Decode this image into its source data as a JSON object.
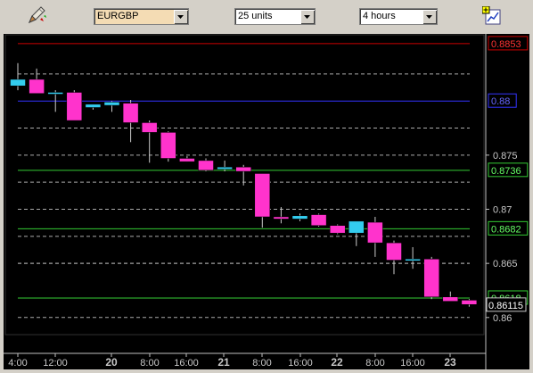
{
  "toolbar": {
    "symbol_value": "EURGBP",
    "units_value": "25 units",
    "interval_value": "4 hours",
    "draw_tool_icon": "pencil-draw-icon",
    "chart_settings_icon": "chart-settings-icon"
  },
  "colors": {
    "up_candle": "#33ccee",
    "down_candle": "#ff33cc",
    "wick": "#cccccc",
    "background": "#000000",
    "red_line": "#cc0000",
    "blue_line": "#3333ff",
    "green_line": "#33cc33"
  },
  "chart_data": {
    "type": "candlestick",
    "instrument": "EURGBP",
    "ylim": [
      0.8585,
      0.8862
    ],
    "y_ticks": [
      "0.875",
      "0.87",
      "0.865",
      "0.86"
    ],
    "x_tick_labels": [
      "4:00",
      "12:00",
      "20",
      "8:00",
      "16:00",
      "21",
      "8:00",
      "16:00",
      "22",
      "8:00",
      "16:00",
      "23"
    ],
    "horizontal_lines": [
      {
        "value": 0.8853,
        "label": "0.8853",
        "color": "red",
        "style": "solid"
      },
      {
        "value": 0.88,
        "label": "0.88",
        "color": "blue",
        "style": "solid"
      },
      {
        "value": 0.8736,
        "label": "0.8736",
        "color": "green",
        "style": "solid"
      },
      {
        "value": 0.8682,
        "label": "0.8682",
        "color": "green",
        "style": "solid"
      },
      {
        "value": 0.8618,
        "label": "0.8618",
        "color": "green",
        "style": "solid"
      }
    ],
    "current_price": "0.86115",
    "candles": [
      {
        "o": 0.8814,
        "h": 0.8835,
        "l": 0.881,
        "c": 0.882
      },
      {
        "o": 0.882,
        "h": 0.883,
        "l": 0.8807,
        "c": 0.8807
      },
      {
        "o": 0.8808,
        "h": 0.881,
        "l": 0.879,
        "c": 0.8808
      },
      {
        "o": 0.8808,
        "h": 0.881,
        "l": 0.879,
        "c": 0.8782
      },
      {
        "o": 0.8794,
        "h": 0.8797,
        "l": 0.8792,
        "c": 0.8797
      },
      {
        "o": 0.8796,
        "h": 0.88,
        "l": 0.879,
        "c": 0.8799
      },
      {
        "o": 0.8798,
        "h": 0.8801,
        "l": 0.8762,
        "c": 0.878
      },
      {
        "o": 0.878,
        "h": 0.8782,
        "l": 0.8743,
        "c": 0.8771
      },
      {
        "o": 0.8771,
        "h": 0.8772,
        "l": 0.8744,
        "c": 0.8747
      },
      {
        "o": 0.8747,
        "h": 0.8749,
        "l": 0.8744,
        "c": 0.8744
      },
      {
        "o": 0.8745,
        "h": 0.8747,
        "l": 0.8735,
        "c": 0.8736
      },
      {
        "o": 0.8737,
        "h": 0.8745,
        "l": 0.8735,
        "c": 0.8739
      },
      {
        "o": 0.8739,
        "h": 0.8741,
        "l": 0.8722,
        "c": 0.8735
      },
      {
        "o": 0.8733,
        "h": 0.8733,
        "l": 0.8683,
        "c": 0.8693
      },
      {
        "o": 0.8693,
        "h": 0.8702,
        "l": 0.8687,
        "c": 0.8691
      },
      {
        "o": 0.8691,
        "h": 0.8696,
        "l": 0.8689,
        "c": 0.8694
      },
      {
        "o": 0.8695,
        "h": 0.8696,
        "l": 0.8684,
        "c": 0.8685
      },
      {
        "o": 0.8685,
        "h": 0.8686,
        "l": 0.8677,
        "c": 0.8678
      },
      {
        "o": 0.8678,
        "h": 0.8687,
        "l": 0.8666,
        "c": 0.8689
      },
      {
        "o": 0.8688,
        "h": 0.8693,
        "l": 0.8656,
        "c": 0.8669
      },
      {
        "o": 0.8669,
        "h": 0.8671,
        "l": 0.864,
        "c": 0.8653
      },
      {
        "o": 0.8654,
        "h": 0.8665,
        "l": 0.8645,
        "c": 0.8654
      },
      {
        "o": 0.8654,
        "h": 0.8656,
        "l": 0.8617,
        "c": 0.8619
      },
      {
        "o": 0.8619,
        "h": 0.8624,
        "l": 0.8616,
        "c": 0.8615
      },
      {
        "o": 0.8616,
        "h": 0.8617,
        "l": 0.861,
        "c": 0.8612
      }
    ]
  }
}
